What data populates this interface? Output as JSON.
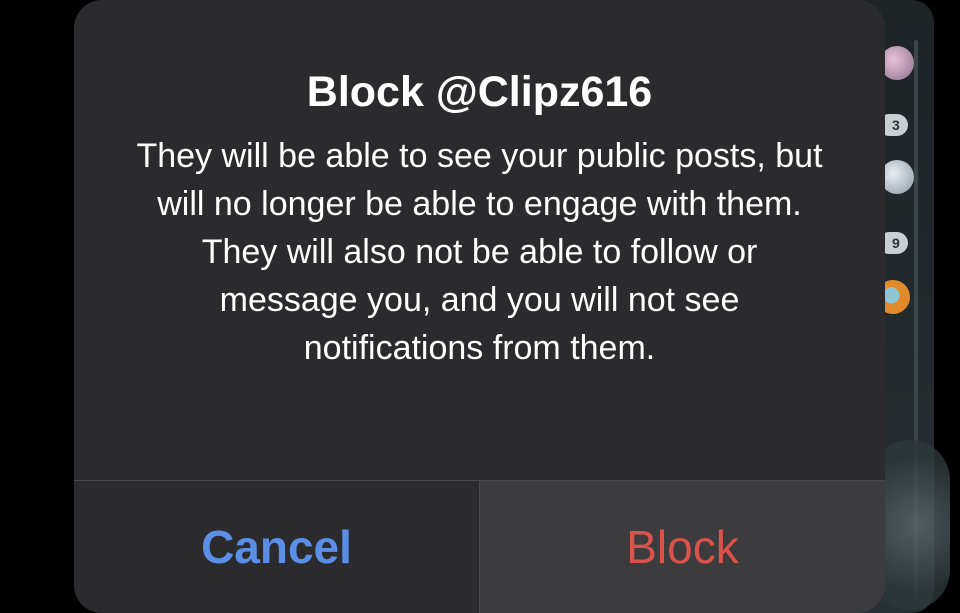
{
  "background": {
    "badges": [
      "3",
      "9"
    ]
  },
  "alert": {
    "title": "Block @Clipz616",
    "message": "They will be able to see your public posts, but will no longer be able to engage with them. They will also not be able to follow or message you, and you will not see notifications from them.",
    "cancel_label": "Cancel",
    "confirm_label": "Block"
  },
  "colors": {
    "dialog_background": "#2b2b2d",
    "pressed_button_background": "#3c3c3f",
    "cancel_text": "#5b8fe6",
    "destructive_text": "#d9534b"
  }
}
